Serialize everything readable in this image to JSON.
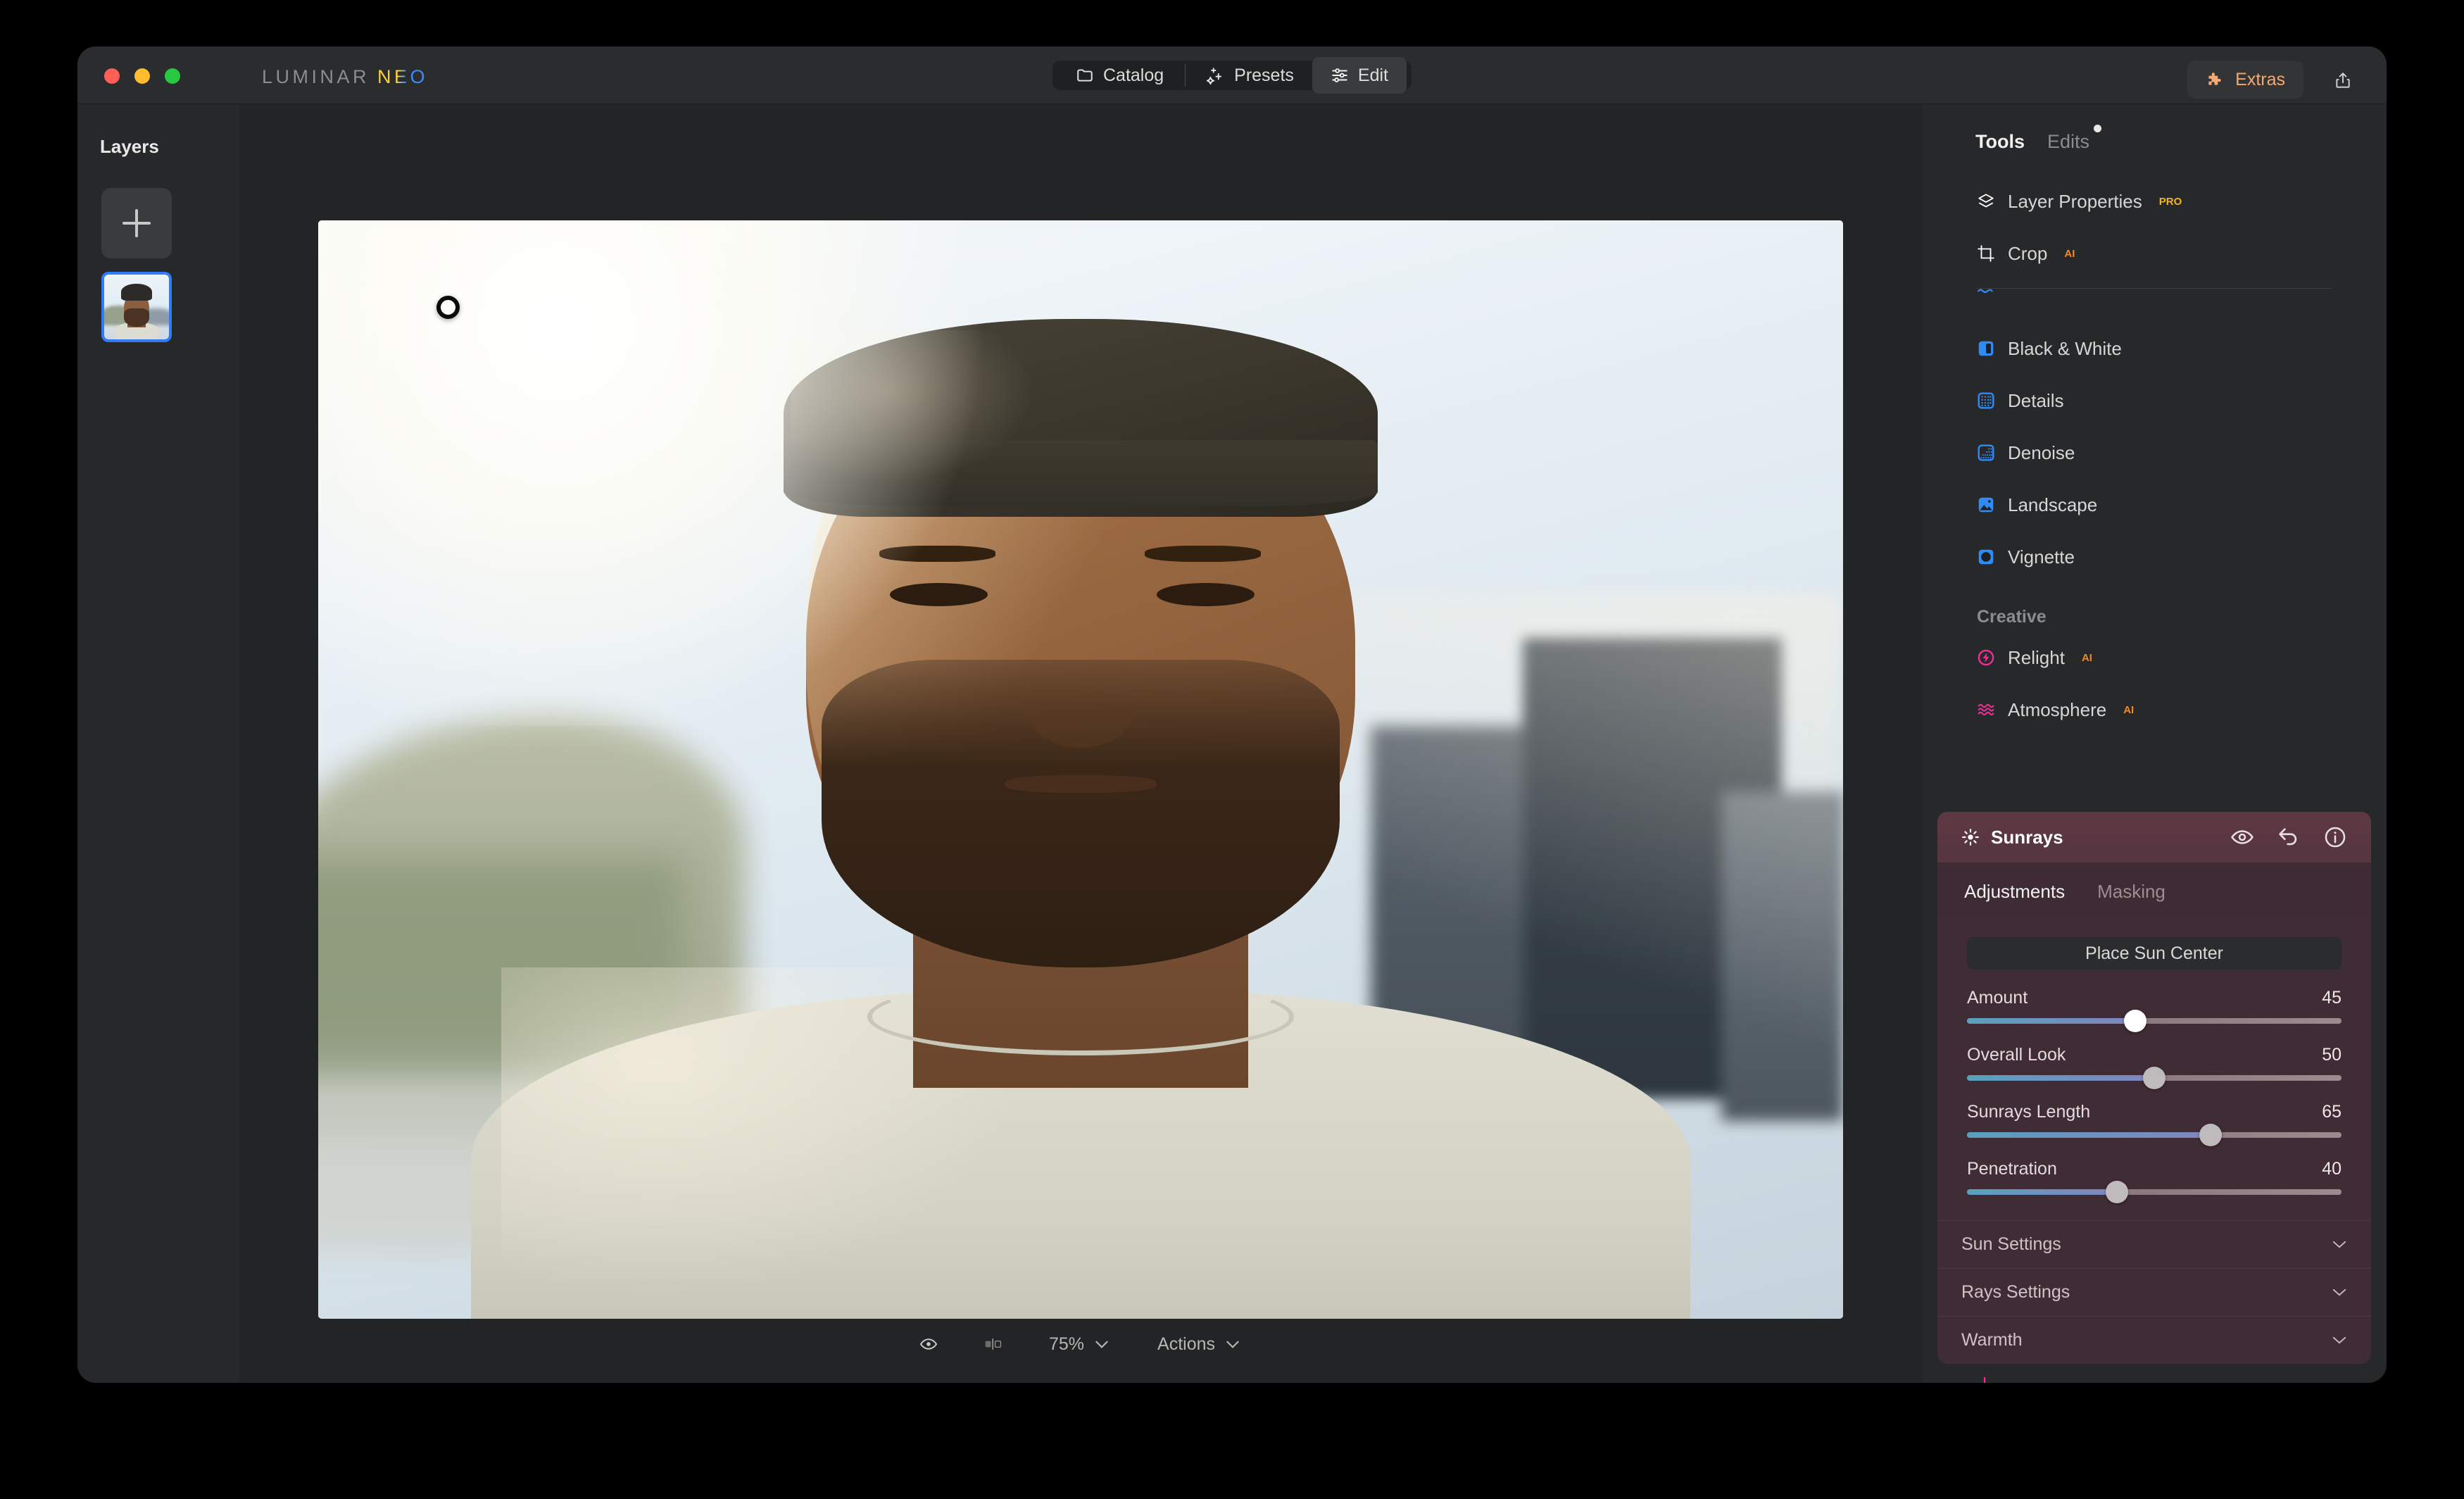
{
  "app": {
    "brand_primary": "LUMINAR",
    "brand_secondary": "NEO"
  },
  "titlebar": {
    "modes": [
      {
        "label": "Catalog",
        "icon": "folder-icon",
        "active": false
      },
      {
        "label": "Presets",
        "icon": "sparkle-icon",
        "active": false
      },
      {
        "label": "Edit",
        "icon": "sliders-icon",
        "active": true
      }
    ],
    "extras_label": "Extras",
    "extras_icon": "puzzle-icon",
    "extras_color": "#f5a971",
    "share_icon": "share-icon"
  },
  "layers": {
    "title": "Layers",
    "add_button_icon": "plus-icon",
    "selected_layer_border": "#2f7cf6"
  },
  "canvas": {
    "marker": "sun-center-marker"
  },
  "bottombar": {
    "items": [
      {
        "label": "",
        "icon": "eye-icon"
      },
      {
        "label": "",
        "icon": "compare-split-icon"
      },
      {
        "label": "75%",
        "icon": "chevron-down-icon"
      },
      {
        "label": "Actions",
        "icon": "chevron-down-icon"
      }
    ],
    "zoom_level": "75%",
    "actions_label": "Actions"
  },
  "tools_panel": {
    "tabs": [
      {
        "label": "Tools",
        "active": true,
        "dot": false
      },
      {
        "label": "Edits",
        "active": false,
        "dot": true
      }
    ],
    "items": [
      {
        "label": "Layer Properties",
        "badge": "PRO",
        "badge_kind": "pro",
        "icon": "layers-icon",
        "icon_color": "#ffffff"
      },
      {
        "label": "Crop",
        "badge": "AI",
        "badge_kind": "ai",
        "icon": "crop-icon",
        "icon_color": "#ffffff"
      },
      {
        "label": "Black & White",
        "badge": "",
        "badge_kind": "",
        "icon": "black-white-icon",
        "icon_color": "#2f8bf6"
      },
      {
        "label": "Details",
        "badge": "",
        "badge_kind": "",
        "icon": "details-icon",
        "icon_color": "#2f8bf6"
      },
      {
        "label": "Denoise",
        "badge": "",
        "badge_kind": "",
        "icon": "denoise-icon",
        "icon_color": "#2f8bf6"
      },
      {
        "label": "Landscape",
        "badge": "",
        "badge_kind": "",
        "icon": "landscape-icon",
        "icon_color": "#2f8bf6"
      },
      {
        "label": "Vignette",
        "badge": "",
        "badge_kind": "",
        "icon": "vignette-icon",
        "icon_color": "#2f8bf6"
      }
    ],
    "creative_label": "Creative",
    "creative_items": [
      {
        "label": "Relight",
        "badge": "AI",
        "badge_kind": "ai",
        "icon": "relight-icon",
        "icon_color": "#f02f9a"
      },
      {
        "label": "Atmosphere",
        "badge": "AI",
        "badge_kind": "ai",
        "icon": "atmosphere-icon",
        "icon_color": "#f02f9a"
      }
    ]
  },
  "sunrays": {
    "title": "Sunrays",
    "title_icon": "sun-icon",
    "header_color": "#5e3843",
    "actions": [
      {
        "icon": "eye-icon",
        "name": "toggle-visibility"
      },
      {
        "icon": "undo-icon",
        "name": "reset-tool"
      },
      {
        "icon": "info-icon",
        "name": "tool-info"
      }
    ],
    "tabs": [
      {
        "label": "Adjustments",
        "active": true
      },
      {
        "label": "Masking",
        "active": false
      }
    ],
    "place_sun_label": "Place Sun Center",
    "sliders": [
      {
        "label": "Amount",
        "value": 45,
        "percent": 45,
        "bright_knob": true
      },
      {
        "label": "Overall Look",
        "value": 50,
        "percent": 50,
        "bright_knob": false
      },
      {
        "label": "Sunrays Length",
        "value": 65,
        "percent": 65,
        "bright_knob": false
      },
      {
        "label": "Penetration",
        "value": 40,
        "percent": 40,
        "bright_knob": false
      }
    ],
    "collapsed_sections": [
      {
        "label": "Sun Settings",
        "icon": "chevron-down-icon"
      },
      {
        "label": "Rays Settings",
        "icon": "chevron-down-icon"
      },
      {
        "label": "Warmth",
        "icon": "chevron-down-icon"
      }
    ]
  }
}
